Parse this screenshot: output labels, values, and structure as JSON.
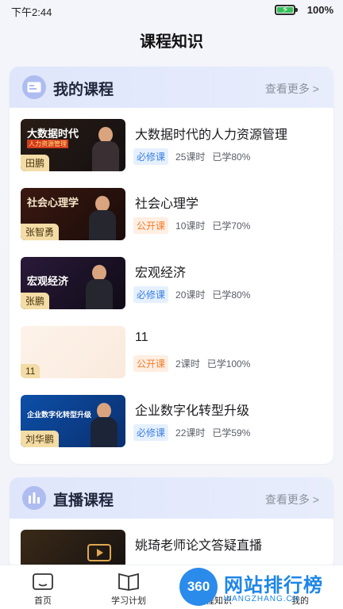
{
  "status": {
    "time": "下午2:44",
    "battery": "100%"
  },
  "page": {
    "title": "课程知识"
  },
  "my_courses": {
    "title": "我的课程",
    "more": "查看更多 >",
    "items": [
      {
        "title": "大数据时代的人力资源管理",
        "tag": "必修课",
        "tag_type": "required",
        "lessons": "25课时",
        "progress": "已学80%",
        "teacher": "田鹏",
        "thumb_line1": "大数据时代",
        "thumb_line2": "人力资源管理"
      },
      {
        "title": "社会心理学",
        "tag": "公开课",
        "tag_type": "public",
        "lessons": "10课时",
        "progress": "已学70%",
        "teacher": "张智勇",
        "thumb_line1": "社会心理学",
        "thumb_line2": ""
      },
      {
        "title": "宏观经济",
        "tag": "必修课",
        "tag_type": "required",
        "lessons": "20课时",
        "progress": "已学80%",
        "teacher": "张鹏",
        "thumb_line1": "宏观经济",
        "thumb_line2": ""
      },
      {
        "title": "11",
        "tag": "公开课",
        "tag_type": "public",
        "lessons": "2课时",
        "progress": "已学100%",
        "teacher": "11",
        "thumb_line1": "",
        "thumb_line2": ""
      },
      {
        "title": "企业数字化转型升级",
        "tag": "必修课",
        "tag_type": "required",
        "lessons": "22课时",
        "progress": "已学59%",
        "teacher": "刘华鹏",
        "thumb_line1": "企业数字化转型升级",
        "thumb_line2": ""
      }
    ]
  },
  "live_courses": {
    "title": "直播课程",
    "more": "查看更多 >",
    "items": [
      {
        "title": "姚琦老师论文答疑直播"
      }
    ]
  },
  "tabbar": [
    {
      "label": "首页",
      "icon": "home-icon"
    },
    {
      "label": "学习计划",
      "icon": "book-icon"
    },
    {
      "label": "课程知识",
      "icon": "course-icon"
    },
    {
      "label": "我的",
      "icon": "profile-icon"
    }
  ],
  "watermark": {
    "badge": "360",
    "main": "网站排行榜",
    "sub": "WANGZHANG.CN"
  },
  "colors": {
    "required_tag": "#3b7fe0",
    "public_tag": "#f07d2c",
    "header_bg": "#dfe6fb",
    "watermark": "#1e86e6"
  }
}
